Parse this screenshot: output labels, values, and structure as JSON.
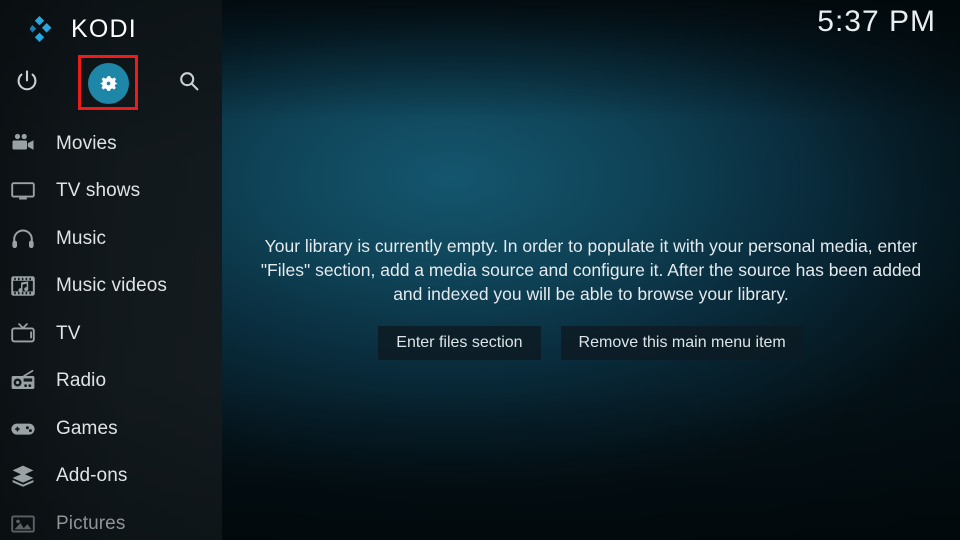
{
  "app": {
    "name": "KODI",
    "logo_icon": "kodi-logo-icon",
    "accent_color": "#1e87a8",
    "highlight_color": "#ee1b1b",
    "background_color": "#0f4357",
    "sidebar_color": "#141b1f"
  },
  "header": {
    "clock": "5:37 PM"
  },
  "toolbar": {
    "power_label": "power-icon",
    "settings_label": "settings-gear-icon",
    "search_label": "search-icon"
  },
  "sidebar": {
    "items": [
      {
        "label": "Movies",
        "icon": "movie-camera-icon",
        "dim": false
      },
      {
        "label": "TV shows",
        "icon": "monitor-icon",
        "dim": false
      },
      {
        "label": "Music",
        "icon": "headphones-icon",
        "dim": false
      },
      {
        "label": "Music videos",
        "icon": "film-note-icon",
        "dim": false
      },
      {
        "label": "TV",
        "icon": "television-icon",
        "dim": false
      },
      {
        "label": "Radio",
        "icon": "radio-icon",
        "dim": false
      },
      {
        "label": "Games",
        "icon": "gamepad-icon",
        "dim": false
      },
      {
        "label": "Add-ons",
        "icon": "package-box-icon",
        "dim": false
      },
      {
        "label": "Pictures",
        "icon": "picture-icon",
        "dim": true
      }
    ]
  },
  "main": {
    "empty_message": "Your library is currently empty. In order to populate it with your personal media, enter \"Files\" section, add a media source and configure it. After the source has been added and indexed you will be able to browse your library.",
    "buttons": [
      {
        "label": "Enter files section"
      },
      {
        "label": "Remove this main menu item"
      }
    ]
  }
}
